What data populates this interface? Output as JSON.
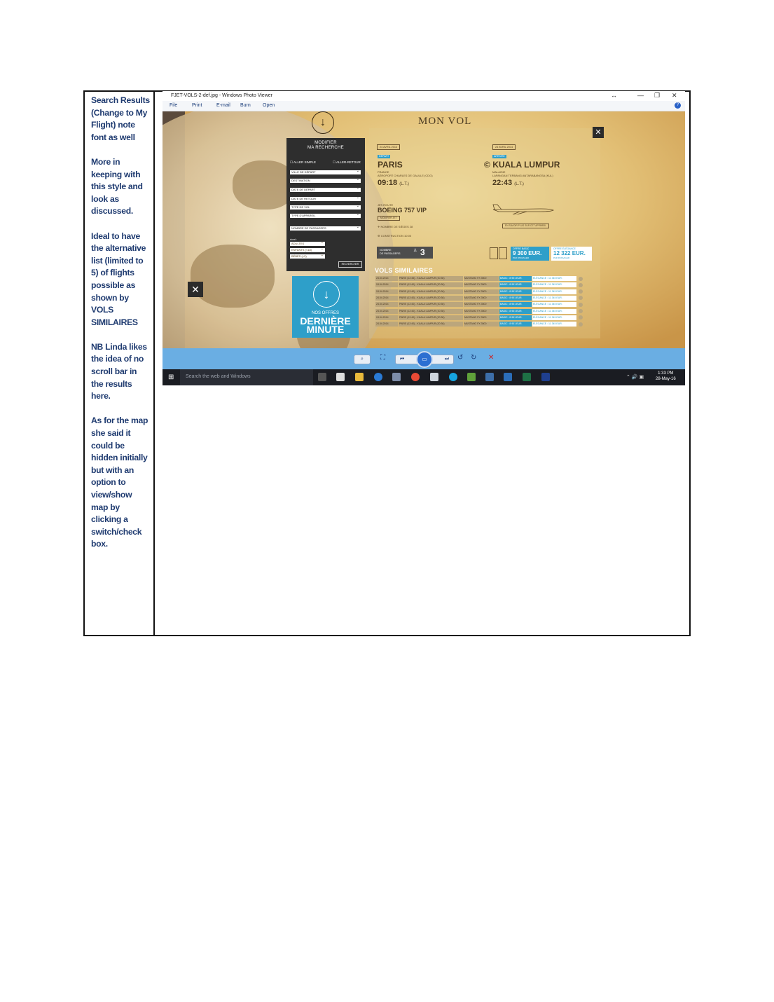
{
  "notes": [
    "Search Results (Change to My Flight) note font as well",
    "More in keeping with this style and look as discussed.",
    "Ideal to have the alternative list (limited to 5) of flights possible as shown by VOLS SIMILAIRES",
    "NB Linda likes the idea of no scroll bar in the results here.",
    "As for the map she said it could be hidden initially but with an option to view/show map by clicking a switch/check box."
  ],
  "window": {
    "title": "FJET-VOLS-2-def.jpg - Windows Photo Viewer",
    "menu": [
      "File",
      "Print",
      "E-mail",
      "Burn",
      "Open"
    ],
    "controls": [
      "↔",
      "—",
      "❐",
      "✕"
    ]
  },
  "page": {
    "heading": "MON VOL",
    "form": {
      "title_line1": "MODIFIER",
      "title_line2": "MA RECHERCHE",
      "option_simple": "ALLER SIMPLE",
      "option_retour": "ALLER-RETOUR",
      "fields": [
        "VILLE DE DÉPART",
        "DESTINATION",
        "DATE DE DÉPART",
        "DATE DE RETOUR",
        "TYPE DE VOL",
        "TYPE D'APPAREIL"
      ],
      "passengers": "NOMBRE DE PASSAGERS",
      "dont": "dont :",
      "sub_fields": [
        "ADULTES",
        "ENFANTS (<18)",
        "BÉBÉS (<2)"
      ],
      "search_button": "RECHERCHER"
    },
    "promo": {
      "line1": "NOS OFFRES",
      "line2": "DERNIÈRE",
      "line3": "MINUTE"
    },
    "departure": {
      "date": "24 AVRIL 2014",
      "badge": "DÉPART",
      "city": "PARIS",
      "country": "FRANCE",
      "airport": "AÉROPORT CHARLES DE GAULLE (CDG)",
      "time": "09:18",
      "tz": "(L.T.)"
    },
    "arrival": {
      "date": "24 AVRIL 2014",
      "badge": "ARRIVÉE",
      "city": "KUALA LUMPUR",
      "country": "MALAISIE",
      "airport": "LAPANGAN TERBANG ANTARABANGSA (KUL)",
      "time": "22:43",
      "tz": "(L.T.)"
    },
    "aircraft": {
      "label": "JET-ROUTE",
      "model": "BOEING 757 VIP",
      "badge": "MODIFIER JET",
      "seats": "NOMBRE DE SIÈGES 28",
      "construction": "CONSTRUCTION 10:00",
      "link": "EN SAVOIR PLUS SUR CET APPAREIL"
    },
    "passengers": {
      "label1": "NOMBRE",
      "label2": "DE PASSAGERS",
      "count": "3"
    },
    "offers": [
      {
        "label": "OFFRE BASIC",
        "price": "9 300 EUR.",
        "sub": "PAR PASSAGER",
        "color": "#2e9fc9"
      },
      {
        "label": "OFFRE ÉLÉGANCE",
        "price": "12 322 EUR.",
        "sub": "PAR PASSAGER",
        "color": "#ffffff"
      }
    ],
    "vols_title": "VOLS SIMILAIRES",
    "vols": [
      {
        "date": "24.04.2014",
        "route": "PARIS (12:45) - KUALA LUMPUR (20:36)",
        "jet": "MUSTANG FX 3500",
        "basic": "BASIC : 8 901 EUR.",
        "ele": "ÉLÉGANCE : 11 345 EUR."
      },
      {
        "date": "24.04.2014",
        "route": "PARIS (12:40) - KUALA LUMPUR (20:36)",
        "jet": "MUSTANG FX 3500",
        "basic": "BASIC : 8 901 EUR.",
        "ele": "ÉLÉGANCE : 11 345 EUR."
      },
      {
        "date": "24.04.2014",
        "route": "PARIS (12:40) - KUALA LUMPUR (20:36)",
        "jet": "MUSTANG FX 3500",
        "basic": "BASIC : 8 901 EUR.",
        "ele": "ÉLÉGANCE : 11 345 EUR."
      },
      {
        "date": "24.04.2014",
        "route": "PARIS (12:40) - KUALA LUMPUR (20:36)",
        "jet": "MUSTANG FX 3500",
        "basic": "BASIC : 8 901 EUR.",
        "ele": "ÉLÉGANCE : 11 345 EUR."
      },
      {
        "date": "24.04.2014",
        "route": "PARIS (12:40) - KUALA LUMPUR (20:36)",
        "jet": "MUSTANG FX 3500",
        "basic": "BASIC : 8 901 EUR.",
        "ele": "ÉLÉGANCE : 11 345 EUR."
      },
      {
        "date": "24.04.2014",
        "route": "PARIS (12:40) - KUALA LUMPUR (20:36)",
        "jet": "MUSTANG FX 3500",
        "basic": "BASIC : 8 901 EUR.",
        "ele": "ÉLÉGANCE : 11 345 EUR."
      },
      {
        "date": "24.04.2014",
        "route": "PARIS (12:40) - KUALA LUMPUR (20:36)",
        "jet": "MUSTANG FX 3500",
        "basic": "BASIC : 8 901 EUR.",
        "ele": "ÉLÉGANCE : 11 345 EUR."
      },
      {
        "date": "24.04.2014",
        "route": "PARIS (12:40) - KUALA LUMPUR (20:36)",
        "jet": "MUSTANG FX 3500",
        "basic": "BASIC : 8 901 EUR.",
        "ele": "ÉLÉGANCE : 11 345 EUR."
      }
    ]
  },
  "taskbar": {
    "search_placeholder": "Search the web and Windows",
    "time": "1:33 PM",
    "date": "28-May-16"
  }
}
